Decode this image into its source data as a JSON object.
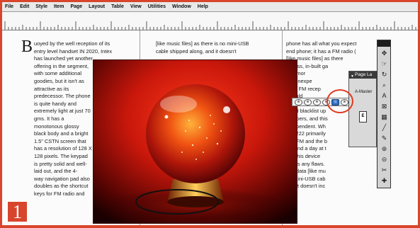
{
  "menubar": {
    "items": [
      "File",
      "Edit",
      "Style",
      "Item",
      "Page",
      "Layout",
      "Table",
      "View",
      "Utilities",
      "Window",
      "Help"
    ]
  },
  "article": {
    "dropcap": "B",
    "col1": [
      "uoyed by the well reception of its",
      "entry level handset IN 2020, Intex",
      "has launched yet another",
      "offering in the segment,",
      "with some additional",
      "goodies, but it isn't as",
      "attractive as its",
      "predecessor. The phone",
      "is quite handy and",
      "extremely light at just 70",
      "gms. It has a",
      "monotonous glossy",
      "black body and a bright",
      "1.5\" CSTN screen that",
      "has a resolution of 128 X",
      "128 pixels. The keypad",
      "is pretty solid and well-",
      "laid out, and the 4-",
      "way navigation pad also",
      "doubles as the shortcut",
      "keys for FM radio and"
    ],
    "col2": [
      "[like music files] as there is no mini-USB",
      "cable shipped along, and it doesn't"
    ],
    "col3": [
      "phone has all what you expect",
      "end phone; it has a FM radio (",
      "[like music files] as there",
      "access, in-built ga",
      "and mor",
      "The inexpe",
      "pack FM recep",
      "it could ",
      "One feature I reall",
      "could blacklist up",
      "numbers, and this",
      "independent. Wh",
      "IN 2222 primarily",
      "and FM and the b",
      "beyond a day at t",
      "But this device",
      "minus any flaws.",
      "any data [like mu",
      "no mini-USB cab",
      "and it doesn't inc"
    ]
  },
  "pages_panel": {
    "title": "Page La",
    "master": "A-Master",
    "page_label": "E"
  },
  "step_badge": "1",
  "colors": {
    "accent": "#d8452c",
    "annotation": "#e03a22",
    "image_bg": "#1a0402"
  }
}
